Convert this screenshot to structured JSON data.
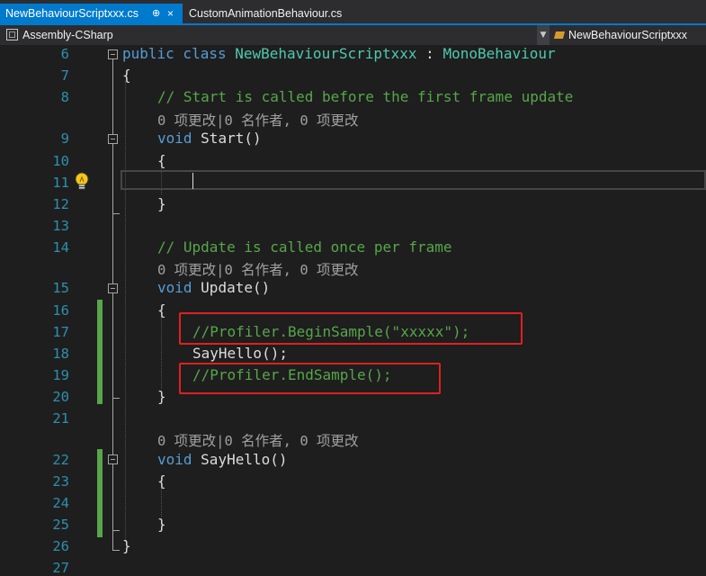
{
  "tabs": [
    {
      "label": "NewBehaviourScriptxxx.cs",
      "pin": "⊕",
      "close": "×",
      "active": true
    },
    {
      "label": "CustomAnimationBehaviour.cs",
      "active": false
    }
  ],
  "nav": {
    "project": "Assembly-CSharp",
    "class": "NewBehaviourScriptxxx",
    "dropdown_glyph": "▼"
  },
  "lens_text": "0 项更改|0 名作者, 0 项更改",
  "lines": {
    "l6": {
      "num": "6",
      "kw": "public class ",
      "ty": "NewBehaviourScriptxxx",
      "tx": " : ",
      "ty2": "MonoBehaviour"
    },
    "l7": {
      "num": "7",
      "tx": "{"
    },
    "l8": {
      "num": "8",
      "cm": "// Start is called before the first frame update"
    },
    "l9": {
      "num": "9",
      "kw": "void ",
      "tx": "Start()"
    },
    "l10": {
      "num": "10",
      "tx": "{"
    },
    "l11": {
      "num": "11"
    },
    "l12": {
      "num": "12",
      "tx": "}"
    },
    "l13": {
      "num": "13"
    },
    "l14": {
      "num": "14",
      "cm": "// Update is called once per frame"
    },
    "l15": {
      "num": "15",
      "kw": "void ",
      "tx": "Update()"
    },
    "l16": {
      "num": "16",
      "tx": "{"
    },
    "l17": {
      "num": "17",
      "cm": "//Profiler.BeginSample(\"xxxxx\");"
    },
    "l18": {
      "num": "18",
      "tx": "SayHello();"
    },
    "l19": {
      "num": "19",
      "cm": "//Profiler.EndSample();"
    },
    "l20": {
      "num": "20",
      "tx": "}"
    },
    "l21": {
      "num": "21"
    },
    "l22": {
      "num": "22",
      "kw": "void ",
      "tx": "SayHello()"
    },
    "l23": {
      "num": "23",
      "tx": "{"
    },
    "l24": {
      "num": "24"
    },
    "l25": {
      "num": "25",
      "tx": "}"
    },
    "l26": {
      "num": "26",
      "tx": "}"
    },
    "l27": {
      "num": "27"
    }
  },
  "colors": {
    "keyword": "#569cd6",
    "type": "#4ec9b0",
    "comment": "#57a64a",
    "line_number": "#2b91af",
    "highlight_box": "#e02020",
    "active_tab": "#007acc"
  }
}
